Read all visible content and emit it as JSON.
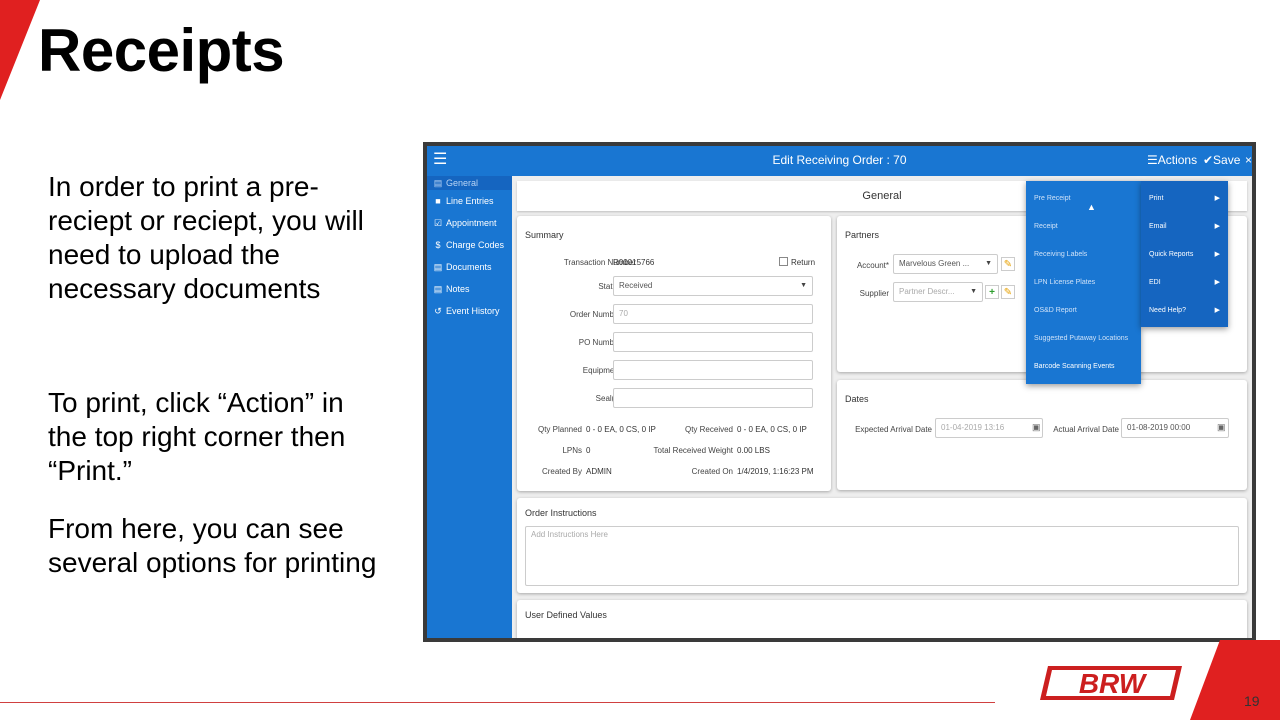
{
  "slide": {
    "title": "Receipts",
    "paragraphs": [
      "In order to print a pre-reciept or reciept, you will need to upload the necessary documents",
      "To print, click “Action” in the top right corner then “Print.”",
      "From here, you can see several options for printing"
    ],
    "page_number": "19",
    "logo_text": "BRW",
    "accent_color": "#e02020"
  },
  "app": {
    "title": "Edit Receiving Order : 70",
    "actions_label": "☰Actions",
    "save_label": "✔Save",
    "close_label": "×",
    "sidebar": [
      {
        "label": "General",
        "icon": "card-icon",
        "glyph": "▤"
      },
      {
        "label": "Line Entries",
        "icon": "clipboard-icon",
        "glyph": "■"
      },
      {
        "label": "Appointment",
        "icon": "calendar-check-icon",
        "glyph": "☑"
      },
      {
        "label": "Charge Codes",
        "icon": "dollar-icon",
        "glyph": "$"
      },
      {
        "label": "Documents",
        "icon": "document-icon",
        "glyph": "▤"
      },
      {
        "label": "Notes",
        "icon": "note-icon",
        "glyph": "▤"
      },
      {
        "label": "Event History",
        "icon": "history-icon",
        "glyph": "↺"
      }
    ],
    "section_title": "General",
    "summary": {
      "title": "Summary",
      "transaction_number_label": "Transaction Number",
      "transaction_number": "R00015766",
      "return_label": "Return",
      "status_label": "Status",
      "status_value": "Received",
      "order_number_label": "Order Number",
      "order_number_value": "70",
      "po_number_label": "PO Number",
      "equipment_label": "Equipment",
      "seals_label": "Seal(s)",
      "qty_planned_label": "Qty Planned",
      "qty_planned": "0 - 0 EA, 0 CS, 0 IP",
      "qty_received_label": "Qty Received",
      "qty_received": "0 - 0 EA, 0 CS, 0 IP",
      "lpns_label": "LPNs",
      "lpns": "0",
      "total_weight_label": "Total Received Weight",
      "total_weight": "0.00 LBS",
      "created_by_label": "Created By",
      "created_by": "ADMIN",
      "created_on_label": "Created On",
      "created_on": "1/4/2019, 1:16:23 PM"
    },
    "partners": {
      "title": "Partners",
      "account_label": "Account*",
      "account_value": "Marvelous Green ...",
      "supplier_label": "Supplier",
      "supplier_placeholder": "Partner Descr..."
    },
    "dates": {
      "title": "Dates",
      "expected_label": "Expected Arrival Date",
      "expected_value": "01-04-2019 13:16",
      "actual_label": "Actual Arrival Date",
      "actual_value": "01-08-2019 00:00"
    },
    "order_instructions": {
      "title": "Order Instructions",
      "placeholder": "Add Instructions Here"
    },
    "user_defined_title": "User Defined Values",
    "actions_menu": [
      {
        "label": "Print"
      },
      {
        "label": "Email"
      },
      {
        "label": "Quick Reports"
      },
      {
        "label": "EDI"
      },
      {
        "label": "Need Help?"
      }
    ],
    "print_submenu": [
      {
        "label": "Pre Receipt"
      },
      {
        "label": "Receipt"
      },
      {
        "label": "Receiving Labels"
      },
      {
        "label": "LPN License Plates"
      },
      {
        "label": "OS&D Report"
      },
      {
        "label": "Suggested Putaway Locations"
      },
      {
        "label": "Barcode Scanning Events"
      }
    ],
    "primary_color": "#1976d2"
  }
}
